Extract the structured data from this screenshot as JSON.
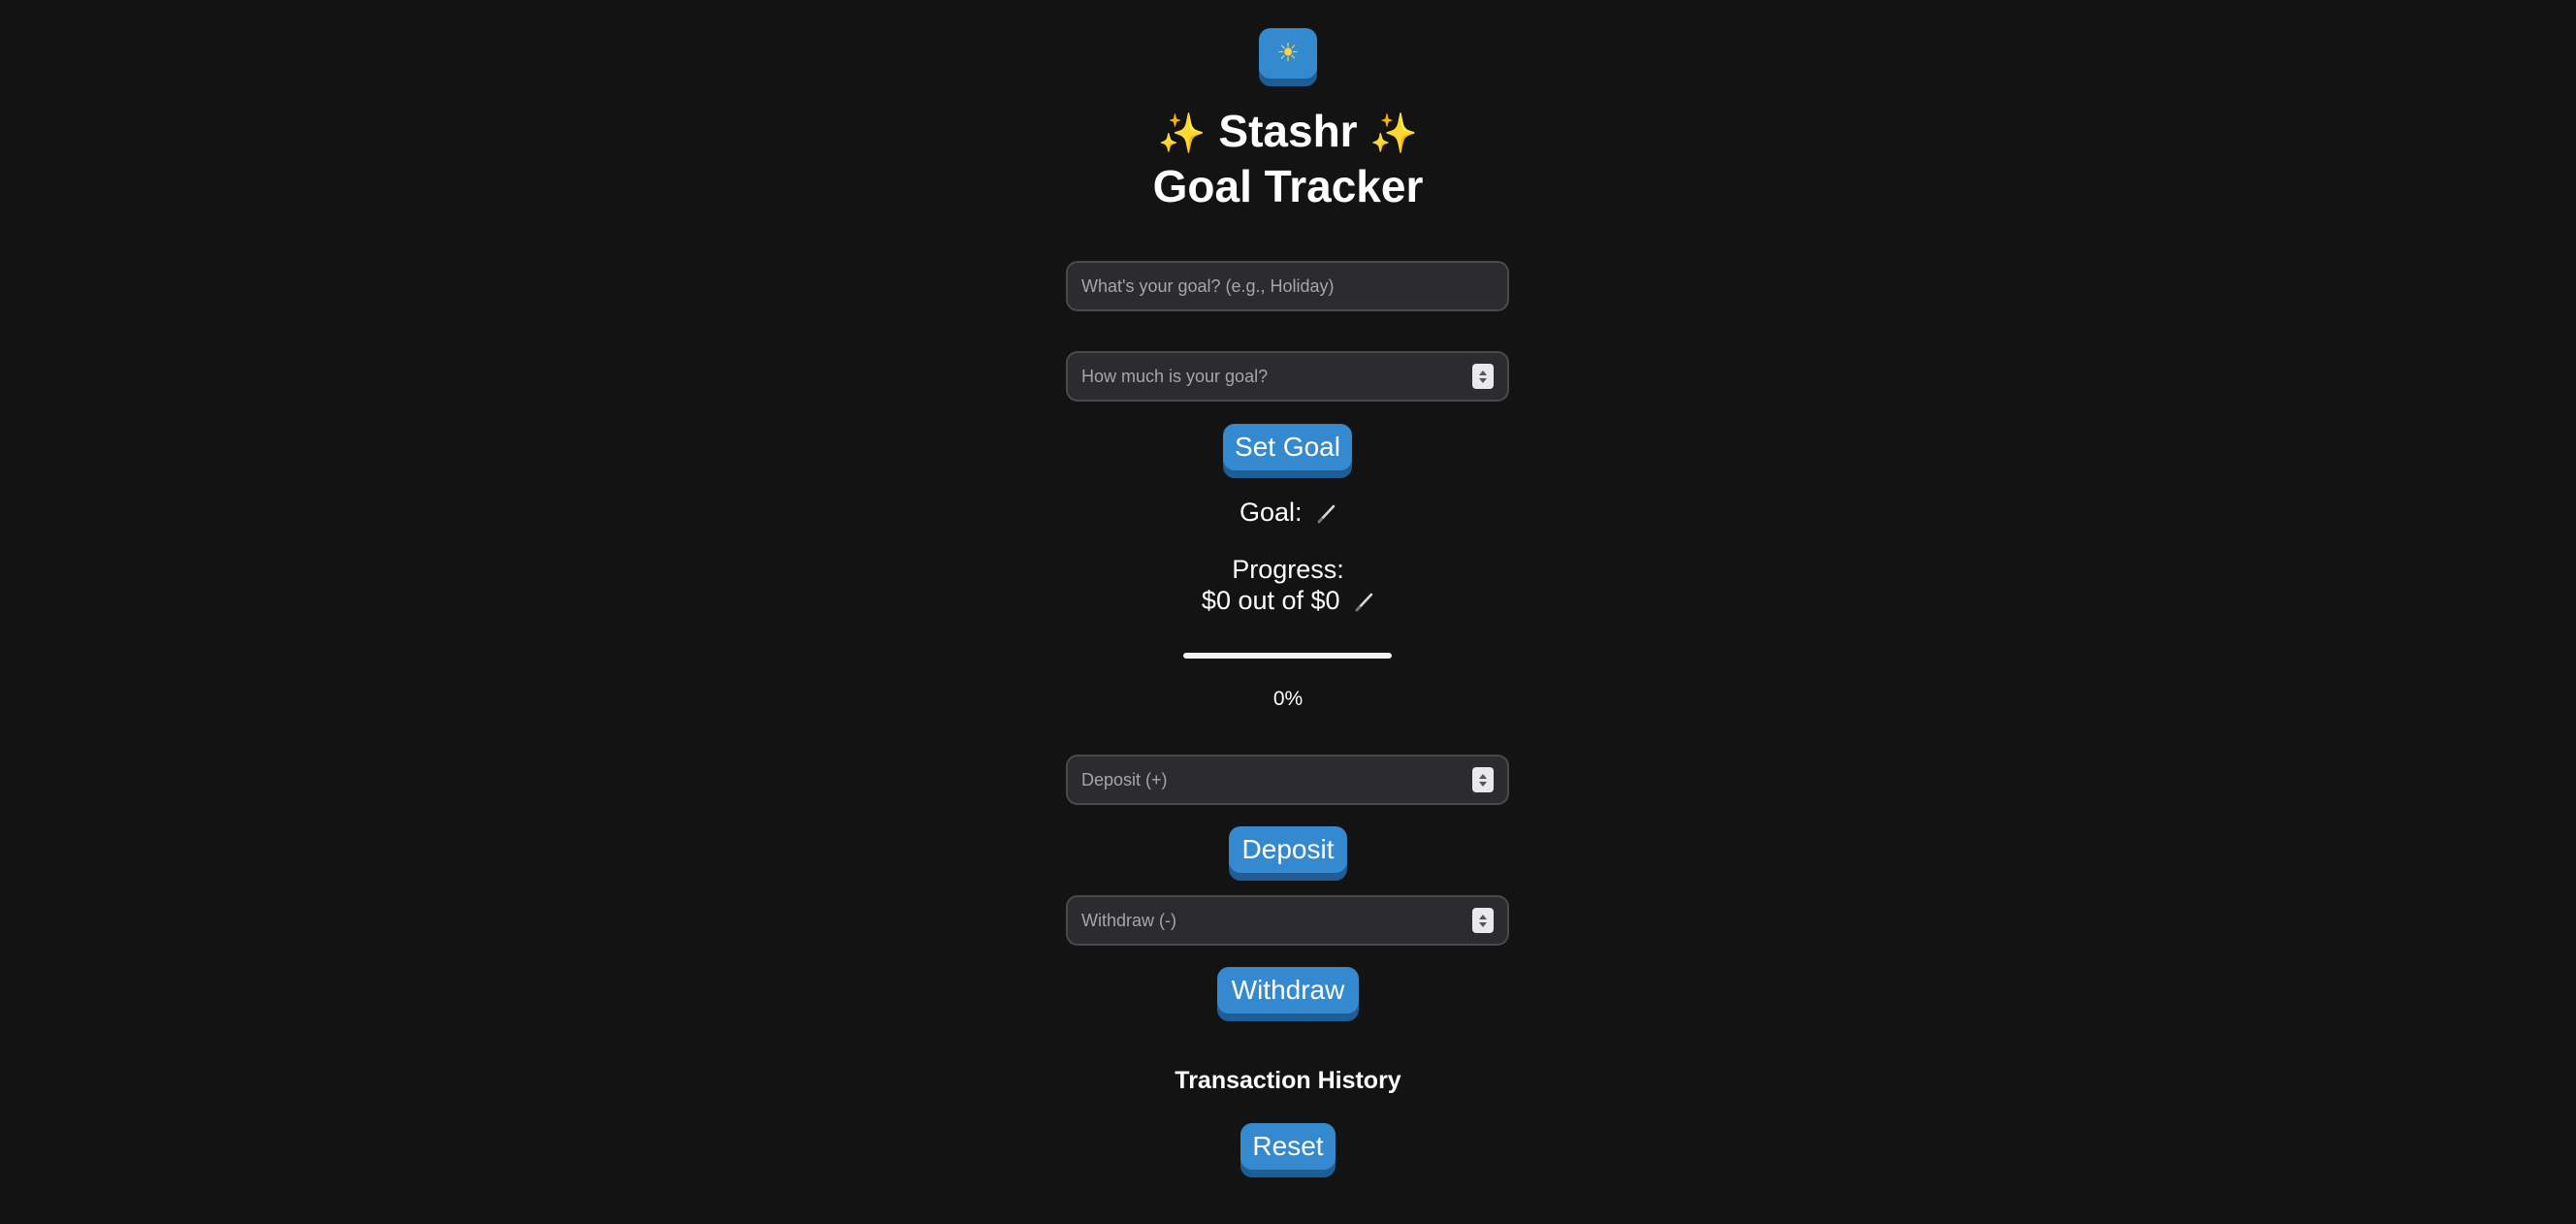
{
  "theme_toggle": {
    "icon": "sun-icon"
  },
  "header": {
    "sparkle_left": "✨",
    "app_name": "Stashr",
    "sparkle_right": "✨",
    "subtitle": "Goal Tracker"
  },
  "goal_form": {
    "name_placeholder": "What's your goal? (e.g., Holiday)",
    "amount_placeholder": "How much is your goal?",
    "set_goal_label": "Set Goal"
  },
  "goal_display": {
    "goal_label": "Goal:",
    "progress_label": "Progress:",
    "progress_text": "$0 out of $0",
    "progress_fraction": 0,
    "percent_text": "0%"
  },
  "deposit": {
    "placeholder": "Deposit (+)",
    "button_label": "Deposit"
  },
  "withdraw": {
    "placeholder": "Withdraw (-)",
    "button_label": "Withdraw"
  },
  "history": {
    "title": "Transaction History",
    "reset_label": "Reset"
  },
  "colors": {
    "background": "#131314",
    "accent": "#3589cf",
    "accent_shadow": "#1f5d96",
    "input_bg": "#2c2c2e"
  }
}
